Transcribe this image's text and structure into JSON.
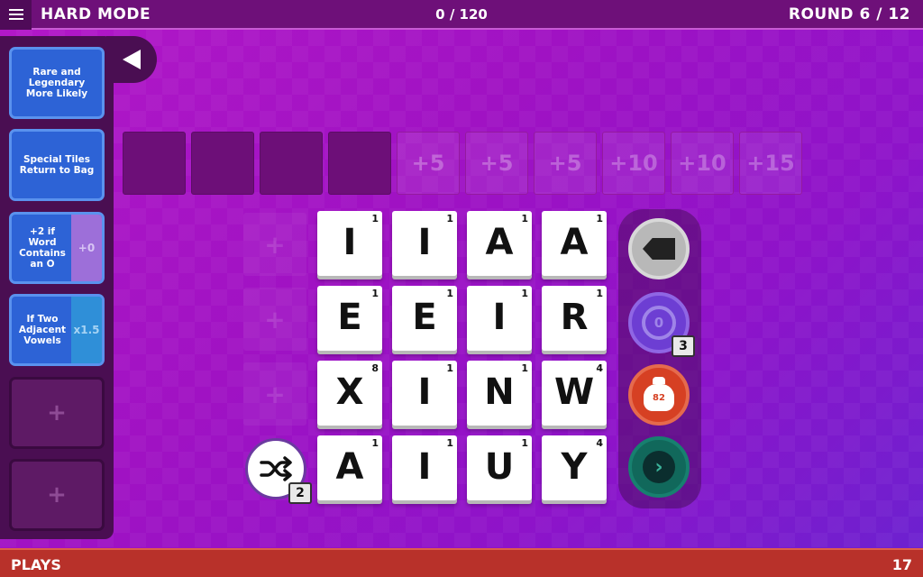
{
  "header": {
    "mode": "HARD MODE",
    "score": "0 / 120",
    "round": "ROUND 6 / 12"
  },
  "perks": [
    {
      "label": "Rare and Legendary More Likely",
      "value": ""
    },
    {
      "label": "Special Tiles Return to Bag",
      "value": ""
    },
    {
      "label": "+2 if Word Contains an O",
      "value": "+0"
    },
    {
      "label": "If Two Adjacent Vowels",
      "value": "x1.5"
    },
    {
      "label": "+",
      "value": ""
    },
    {
      "label": "+",
      "value": ""
    }
  ],
  "word_slots": [
    "",
    "",
    "",
    "",
    "+5",
    "+5",
    "+5",
    "+10",
    "+10",
    "+15"
  ],
  "ghost_slots": [
    "+",
    "+",
    "+"
  ],
  "tiles": [
    [
      {
        "l": "I",
        "p": "1"
      },
      {
        "l": "I",
        "p": "1"
      },
      {
        "l": "A",
        "p": "1"
      },
      {
        "l": "A",
        "p": "1"
      }
    ],
    [
      {
        "l": "E",
        "p": "1"
      },
      {
        "l": "E",
        "p": "1"
      },
      {
        "l": "I",
        "p": "1"
      },
      {
        "l": "R",
        "p": "1"
      }
    ],
    [
      {
        "l": "X",
        "p": "8"
      },
      {
        "l": "I",
        "p": "1"
      },
      {
        "l": "N",
        "p": "1"
      },
      {
        "l": "W",
        "p": "4"
      }
    ],
    [
      {
        "l": "A",
        "p": "1"
      },
      {
        "l": "I",
        "p": "1"
      },
      {
        "l": "U",
        "p": "1"
      },
      {
        "l": "Y",
        "p": "4"
      }
    ]
  ],
  "controls": {
    "undo_count": "0",
    "undo_badge": "3",
    "bag_count": "82",
    "shuffle_badge": "2"
  },
  "footer": {
    "plays_label": "PLAYS",
    "plays_count": "17"
  },
  "colors": {
    "background": "#a716c6",
    "topbar": "#6e1079",
    "perk_card": "#2d63d6",
    "bottombar": "#b8312a",
    "bag_button": "#d64023",
    "next_button": "#11685b",
    "undo_button": "#6d3ed3"
  },
  "icons": {
    "menu": "hamburger-icon",
    "collapse": "triangle-left-icon",
    "delete": "backspace-icon",
    "undo": "undo-icon",
    "bag": "tile-bag-icon",
    "next": "chevron-right-icon",
    "shuffle": "shuffle-icon"
  }
}
